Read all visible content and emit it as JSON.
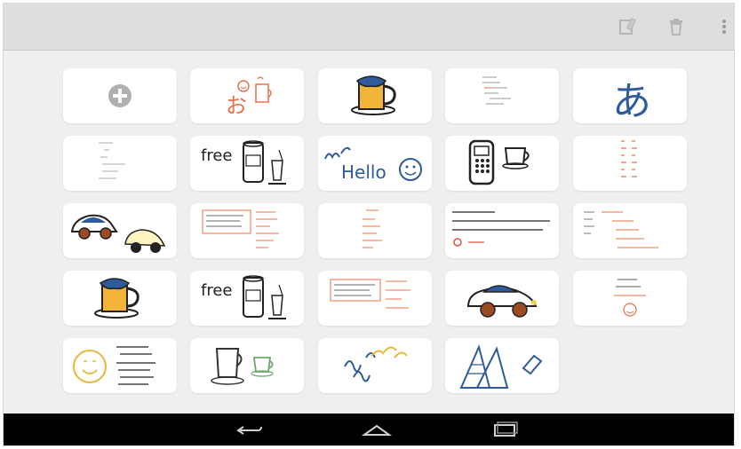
{
  "actionbar": {
    "icons": [
      "edit-icon",
      "delete-icon",
      "overflow-menu-icon"
    ],
    "bg_color": "#dedede"
  },
  "notes": {
    "grid_columns": 5,
    "items": [
      {
        "name": "add-note-tile",
        "icon": "plus-icon",
        "text": ""
      },
      {
        "name": "note-smiley-cup",
        "icon": "drawing",
        "text": "お"
      },
      {
        "name": "note-beer-mug",
        "icon": "drawing",
        "text": ""
      },
      {
        "name": "note-tiny-text",
        "icon": "drawing",
        "text": ""
      },
      {
        "name": "note-hiragana-a",
        "icon": "drawing",
        "text": "あ"
      },
      {
        "name": "note-faint-text",
        "icon": "drawing",
        "text": ""
      },
      {
        "name": "note-free-drinks",
        "icon": "drawing",
        "text": "free"
      },
      {
        "name": "note-hello-smiley",
        "icon": "drawing",
        "text": "Hello"
      },
      {
        "name": "note-phone-cup",
        "icon": "drawing",
        "text": ""
      },
      {
        "name": "note-vertical-japanese",
        "icon": "drawing",
        "text": ""
      },
      {
        "name": "note-two-cars",
        "icon": "drawing",
        "text": ""
      },
      {
        "name": "note-red-sketch",
        "icon": "drawing",
        "text": ""
      },
      {
        "name": "note-red-lines",
        "icon": "drawing",
        "text": ""
      },
      {
        "name": "note-handwritten-text",
        "icon": "drawing",
        "text": ""
      },
      {
        "name": "note-mixed-text",
        "icon": "drawing",
        "text": ""
      },
      {
        "name": "note-beer-mug-2",
        "icon": "drawing",
        "text": ""
      },
      {
        "name": "note-free-drinks-2",
        "icon": "drawing",
        "text": "free"
      },
      {
        "name": "note-red-sketch-2",
        "icon": "drawing",
        "text": ""
      },
      {
        "name": "note-blue-car",
        "icon": "drawing",
        "text": ""
      },
      {
        "name": "note-small-face",
        "icon": "drawing",
        "text": ""
      },
      {
        "name": "note-yellow-smiley",
        "icon": "drawing",
        "text": ""
      },
      {
        "name": "note-coffee-cups",
        "icon": "drawing",
        "text": ""
      },
      {
        "name": "note-blue-yellow-scribbles",
        "icon": "drawing",
        "text": ""
      },
      {
        "name": "note-triangles",
        "icon": "drawing",
        "text": ""
      }
    ]
  },
  "navbar": {
    "buttons": [
      "back-icon",
      "home-icon",
      "recents-icon"
    ]
  },
  "colors": {
    "ink_blue": "#2f5b9a",
    "ink_orange": "#e8724a",
    "ink_black": "#222222",
    "ink_yellow": "#e9b83a",
    "ink_green": "#6fa86b",
    "ink_red": "#d9553b"
  }
}
